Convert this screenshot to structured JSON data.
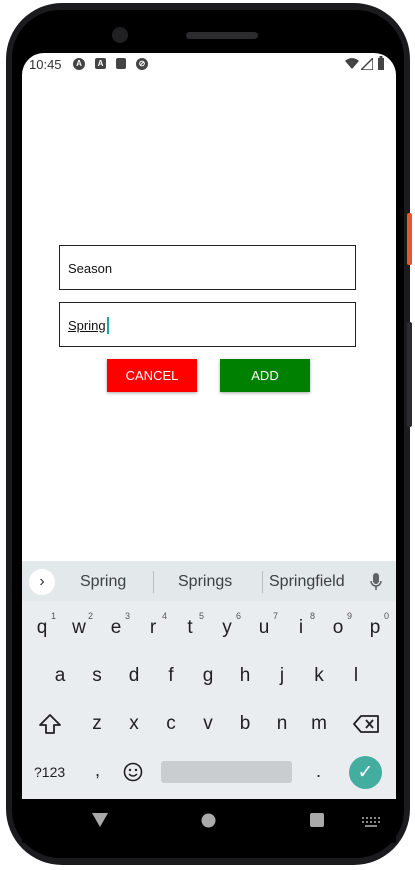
{
  "status_bar": {
    "time": "10:45",
    "icons": [
      "a-icon",
      "a-square-icon",
      "sd-card-icon",
      "sync-off-icon"
    ],
    "right_icons": [
      "wifi-icon",
      "signal-icon",
      "battery-icon"
    ]
  },
  "form": {
    "field1_value": "Season",
    "field2_value": "Spring",
    "cancel_label": "CANCEL",
    "add_label": "ADD",
    "cancel_color": "#ff0000",
    "add_color": "#008000"
  },
  "keyboard": {
    "suggestions": [
      "Spring",
      "Springs",
      "Springfield"
    ],
    "row1": [
      "q",
      "w",
      "e",
      "r",
      "t",
      "y",
      "u",
      "i",
      "o",
      "p"
    ],
    "row1_hints": [
      "1",
      "2",
      "3",
      "4",
      "5",
      "6",
      "7",
      "8",
      "9",
      "0"
    ],
    "row2": [
      "a",
      "s",
      "d",
      "f",
      "g",
      "h",
      "j",
      "k",
      "l"
    ],
    "row3": [
      "z",
      "x",
      "c",
      "v",
      "b",
      "n",
      "m"
    ],
    "symbols_label": "?123",
    "comma": ",",
    "period": ".",
    "accent": "#43ad9f"
  },
  "nav_bar": {
    "buttons": [
      "back-icon",
      "home-icon",
      "recents-icon"
    ]
  }
}
